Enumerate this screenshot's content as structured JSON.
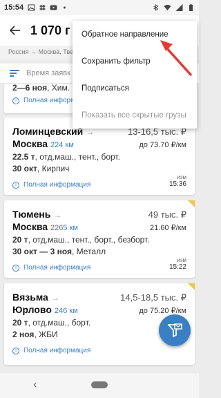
{
  "status_bar": {
    "time": "15:54",
    "left_icons": [
      "image-icon",
      "slack-icon",
      "youtube-icon",
      "dot-icon"
    ],
    "right_icons": [
      "bluetooth-icon",
      "wifi-icon",
      "signal-icon",
      "battery-icon"
    ]
  },
  "header": {
    "title": "1 070 г"
  },
  "breadcrumbs": "Россия → Москва, Тверь, Калуга, Ярославль…",
  "sort": {
    "label": "Время заявк"
  },
  "menu": {
    "items": [
      {
        "label": "Обратное направление",
        "disabled": false
      },
      {
        "label": "Сохранить фильтр",
        "disabled": false
      },
      {
        "label": "Подписаться",
        "disabled": false
      },
      {
        "label": "Показать все скрытые грузы",
        "disabled": true
      }
    ]
  },
  "cards": [
    {
      "date": "2—6 ноя",
      "cargo": ", Хим.",
      "info": "Полная информа"
    },
    {
      "from": "Ломинцевский",
      "to": "Москва",
      "km": "224 км",
      "price": "13-16,5 тыс. ₽",
      "rate": "до 73.70 ₽/км",
      "weight": "22.5 т",
      "body": ", отд.маш., тент., борт.",
      "date": "30 окт",
      "cargo": ", Кирпич",
      "info": "Полная информация",
      "changed_label": "изм",
      "changed_time": "15:36"
    },
    {
      "from": "Тюмень",
      "to": "Москва",
      "km": "2265 км",
      "price": "49 тыс. ₽",
      "rate": "21.60 ₽/км",
      "weight": "20 т",
      "body": ", отд.маш., тент., борт., безборт.",
      "date": "30 окт — 3 ноя",
      "cargo": ", Металл",
      "info": "Полная информация",
      "changed_label": "изм",
      "changed_time": "15:22"
    },
    {
      "from": "Вязьма",
      "to": "Юрлово",
      "km": "246 км",
      "price": "14,5-18,5 тыс. ₽",
      "rate": "до 75.20 ₽/км",
      "weight": "20 т",
      "body": ", отд.маш., борт.",
      "date": "2 ноя",
      "cargo": ", ЖБИ",
      "info": "Полная информация"
    }
  ],
  "colors": {
    "accent": "#3a7fc4",
    "annotation": "#e53935",
    "badge": "#f3c64a"
  }
}
